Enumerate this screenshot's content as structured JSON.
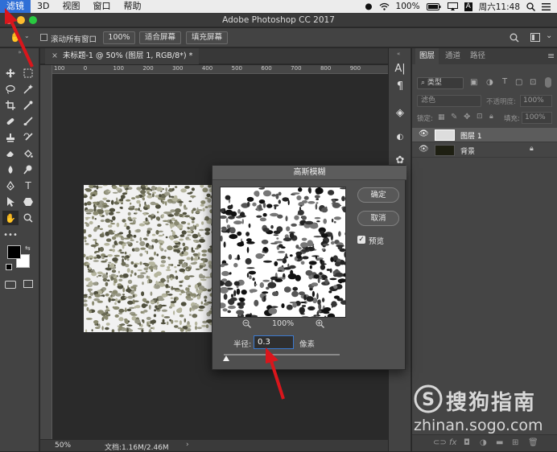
{
  "menubar": {
    "items": [
      "滤镜",
      "3D",
      "视图",
      "窗口",
      "帮助"
    ],
    "battery": "100%",
    "clock": "周六11:48"
  },
  "app_title": "Adobe Photoshop CC 2017",
  "options": {
    "scroll_all_label": "滚动所有窗口",
    "zoom_value": "100%",
    "fit_screen": "适合屏幕",
    "fill_screen": "填充屏幕"
  },
  "document": {
    "tab_label": "未标题-1 @ 50% (图层 1, RGB/8*) *",
    "ruler_top": [
      "100",
      "0",
      "100",
      "200",
      "300",
      "400",
      "500",
      "600",
      "700",
      "800",
      "900"
    ],
    "status_zoom": "50%",
    "status_doc": "文档:1.16M/2.46M"
  },
  "layers_panel": {
    "tabs": [
      "图层",
      "通道",
      "路径"
    ],
    "filter_type": "类型",
    "blend_mode": "滤色",
    "opacity_label": "不透明度:",
    "opacity_value": "100%",
    "lock_label": "锁定:",
    "fill_label": "填充:",
    "fill_value": "100%",
    "layers": [
      {
        "name": "图层 1",
        "selected": true
      },
      {
        "name": "背景",
        "locked": true
      }
    ]
  },
  "dialog": {
    "title": "高斯模糊",
    "ok": "确定",
    "cancel": "取消",
    "preview_label": "预览",
    "preview_checked": true,
    "zoom": "100%",
    "radius_label": "半径:",
    "radius_value": "0.3",
    "radius_unit": "像素",
    "slider_fraction": 0.02
  },
  "watermark": {
    "brand": "搜狗指南",
    "url": "zhinan.sogo.com"
  },
  "colors": {
    "accent": "#2f6fd6",
    "annotation_arrow": "#d9161c"
  }
}
